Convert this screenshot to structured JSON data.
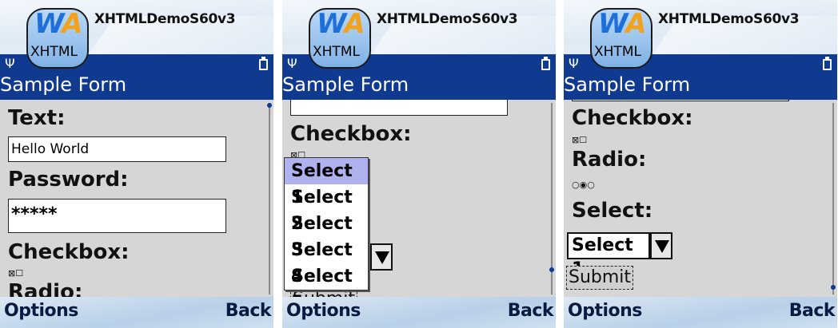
{
  "app_title": "XHTMLDemoS60v3",
  "logo": {
    "w": "W",
    "a": "A",
    "label": "XHTML"
  },
  "page_title": "Sample Form",
  "softkeys": {
    "left": "Options",
    "right": "Back"
  },
  "screen1": {
    "text_label": "Text:",
    "text_value": "Hello World",
    "password_label": "Password:",
    "password_value": "*****",
    "checkbox_label": "Checkbox:",
    "checkbox_glyphs": "⊠☐",
    "radio_label": "Radio:"
  },
  "screen2": {
    "checkbox_label": "Checkbox:",
    "checkbox_glyphs": "⊠☐",
    "options": [
      "Select 1",
      "Select 2",
      "Select 3",
      "Select 4",
      "Select 5"
    ],
    "submit_partial": "Submit"
  },
  "screen3": {
    "checkbox_label": "Checkbox:",
    "checkbox_glyphs": "⊠☐",
    "radio_label": "Radio:",
    "radio_glyphs": "○◉○",
    "select_label": "Select:",
    "select_value": "Select 1",
    "submit_label": "Submit"
  },
  "colors": {
    "status_bar": "#0f3a8f",
    "content_bg": "#d6d6d6",
    "highlight": "#b0b2f0"
  }
}
